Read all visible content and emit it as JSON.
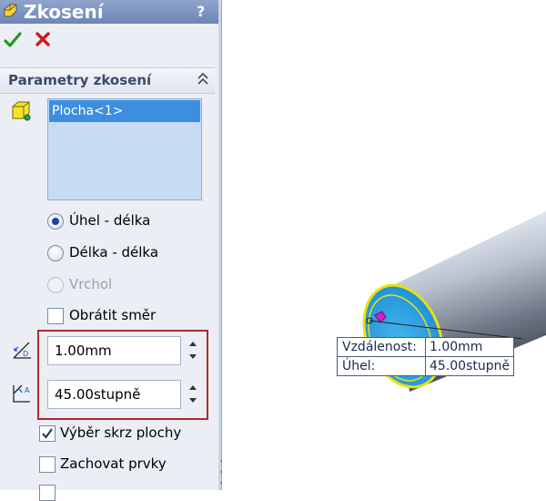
{
  "titlebar": {
    "title": "Zkosení",
    "help": "?"
  },
  "actions": {
    "ok_icon": "check-icon",
    "cancel_icon": "cross-icon"
  },
  "group": {
    "title": "Parametry zkosení",
    "selection": {
      "items": [
        "Plocha<1>"
      ]
    },
    "chamfer_types": [
      {
        "label": "Úhel - délka",
        "checked": true,
        "enabled": true
      },
      {
        "label": "Délka - délka",
        "checked": false,
        "enabled": true
      },
      {
        "label": "Vrchol",
        "checked": false,
        "enabled": false
      }
    ],
    "reverse_direction": {
      "label": "Obrátit směr",
      "checked": false
    },
    "distance": {
      "value": "1.00mm"
    },
    "angle": {
      "value": "45.00stupně"
    },
    "tangent_propagation": {
      "label": "Výběr skrz plochy",
      "checked": true
    },
    "keep_features": {
      "label": "Zachovat prvky",
      "checked": false
    }
  },
  "callout": {
    "rows": [
      {
        "key": "Vzdálenost:",
        "value": "1.00mm"
      },
      {
        "key": "Úhel:",
        "value": "45.00stupně"
      }
    ]
  },
  "colors": {
    "accent_frame": "#b3282d",
    "selection_bg": "#3d8ee0",
    "title_bg": "#7b91c2"
  }
}
